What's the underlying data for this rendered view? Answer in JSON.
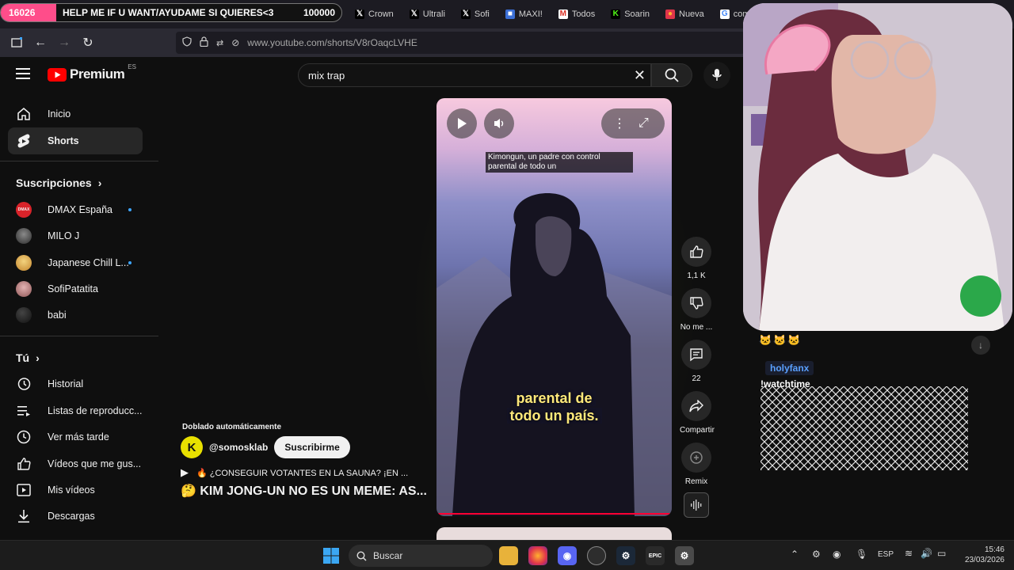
{
  "stream": {
    "count": "16026",
    "text": "HELP ME IF U WANT/AYUDAME SI QUIERES<3",
    "goal": "100000"
  },
  "tabs": [
    {
      "label": "Crown",
      "icon": "x-logo-icon"
    },
    {
      "label": "Ultrali",
      "icon": "x-logo-icon"
    },
    {
      "label": "Sofi",
      "icon": "x-logo-icon"
    },
    {
      "label": "MAXI!",
      "icon": "app-icon"
    },
    {
      "label": "Todos",
      "icon": "gmail-icon"
    },
    {
      "label": "Soarin",
      "icon": "kick-icon"
    },
    {
      "label": "Nueva",
      "icon": "firefox-icon"
    },
    {
      "label": "como",
      "icon": "google-icon"
    }
  ],
  "url": "www.youtube.com/shorts/V8rOaqcLVHE",
  "yt": {
    "logo": "Premium",
    "logo_region": "ES",
    "search_value": "mix trap",
    "nav": [
      {
        "label": "Inicio",
        "icon": "home-icon"
      },
      {
        "label": "Shorts",
        "icon": "shorts-icon"
      }
    ],
    "subs_title": "Suscripciones",
    "subs": [
      {
        "label": "DMAX España",
        "color": "#d9232a",
        "new": true
      },
      {
        "label": "MILO J",
        "color": "#555555",
        "new": false
      },
      {
        "label": "Japanese Chill L...",
        "color": "#e0b04a",
        "new": true
      },
      {
        "label": "SofiPatatita",
        "color": "#c98a8a",
        "new": false
      },
      {
        "label": "babi",
        "color": "#222222",
        "new": false
      }
    ],
    "you_title": "Tú",
    "you": [
      {
        "label": "Historial",
        "icon": "history-icon"
      },
      {
        "label": "Listas de reproducc...",
        "icon": "playlist-icon"
      },
      {
        "label": "Ver más tarde",
        "icon": "clock-icon"
      },
      {
        "label": "Vídeos que me gus...",
        "icon": "thumb-up-icon"
      },
      {
        "label": "Mis vídeos",
        "icon": "video-icon"
      },
      {
        "label": "Descargas",
        "icon": "download-icon"
      }
    ]
  },
  "short": {
    "caption_top": "Kimongun, un padre con control parental de todo un",
    "caption_main_1": "parental de",
    "caption_main_2": "todo un país.",
    "dub_label": "Doblado automáticamente",
    "channel": "@somosklab",
    "subscribe": "Suscribirme",
    "sound_line": "🔥 ¿CONSEGUIR VOTANTES EN LA SAUNA? ¡EN ...",
    "title": "🤔 KIM JONG-UN NO ES UN MEME: AS...",
    "actions": {
      "likes": "1,1 K",
      "dislike": "No me ...",
      "comments": "22",
      "share": "Compartir",
      "remix": "Remix"
    }
  },
  "chat": {
    "user": "holyfanx",
    "message": "!watchtime",
    "emote_rows": 4
  },
  "taskbar": {
    "search": "Buscar",
    "lang": "ESP",
    "time": "15:46",
    "date": "23/03/2026"
  },
  "colors": {
    "yt_red": "#ff0000",
    "accent_pink": "#ff4d8a",
    "progress_red": "#ff0033"
  }
}
